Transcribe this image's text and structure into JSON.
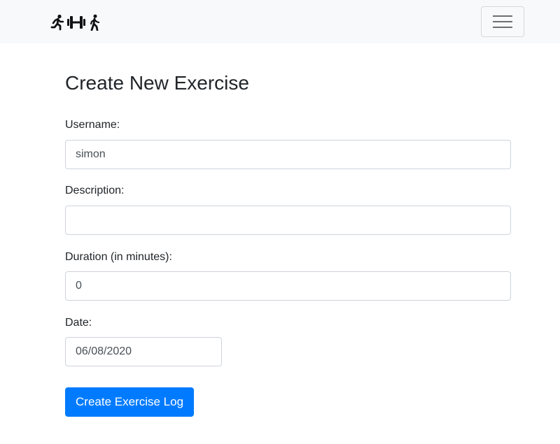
{
  "navbar": {
    "brand_icons": [
      "running-icon",
      "dumbbell-icon",
      "walking-icon"
    ],
    "toggler_icon": "hamburger-menu-icon"
  },
  "form": {
    "title": "Create New Exercise",
    "username_label": "Username:",
    "username_value": "simon",
    "description_label": "Description:",
    "description_value": "",
    "duration_label": "Duration (in minutes):",
    "duration_value": "0",
    "date_label": "Date:",
    "date_value": "06/08/2020",
    "submit_label": "Create Exercise Log"
  },
  "colors": {
    "navbar_bg": "#f8f9fa",
    "primary": "#007bff",
    "input_border": "#ced4da"
  }
}
